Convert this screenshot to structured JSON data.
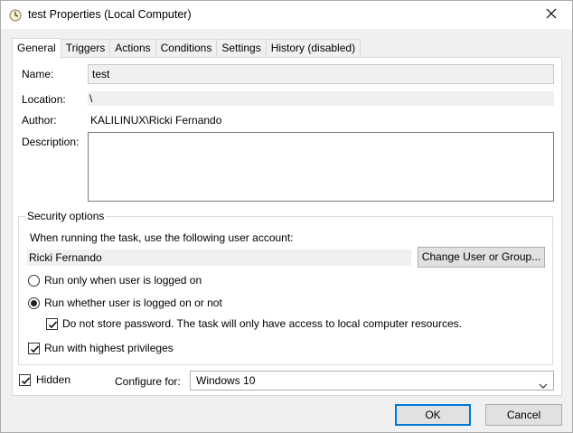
{
  "window": {
    "title": "test Properties (Local Computer)"
  },
  "tabs": [
    {
      "label": "General",
      "active": true
    },
    {
      "label": "Triggers",
      "active": false
    },
    {
      "label": "Actions",
      "active": false
    },
    {
      "label": "Conditions",
      "active": false
    },
    {
      "label": "Settings",
      "active": false
    },
    {
      "label": "History (disabled)",
      "active": false
    }
  ],
  "general": {
    "name_label": "Name:",
    "name_value": "test",
    "location_label": "Location:",
    "location_value": "\\",
    "author_label": "Author:",
    "author_value": "KALILINUX\\Ricki Fernando",
    "description_label": "Description:",
    "description_value": ""
  },
  "security": {
    "group_title": "Security options",
    "account_prompt": "When running the task, use the following user account:",
    "account_value": "Ricki Fernando",
    "change_button": "Change User or Group...",
    "radio_logged_on": "Run only when user is logged on",
    "radio_logged_on_checked": false,
    "radio_whether": "Run whether user is logged on or not",
    "radio_whether_checked": true,
    "no_store_password": "Do not store password.  The task will only have access to local computer resources.",
    "no_store_password_checked": true,
    "highest_privileges": "Run with highest privileges",
    "highest_privileges_checked": true
  },
  "bottom": {
    "hidden_label": "Hidden",
    "hidden_checked": true,
    "configure_label": "Configure for:",
    "configure_value": "Windows 10"
  },
  "buttons": {
    "ok": "OK",
    "cancel": "Cancel"
  },
  "colors": {
    "accent": "#0078d7",
    "window_bg": "#f0f0f0",
    "panel_bg": "#ffffff"
  }
}
